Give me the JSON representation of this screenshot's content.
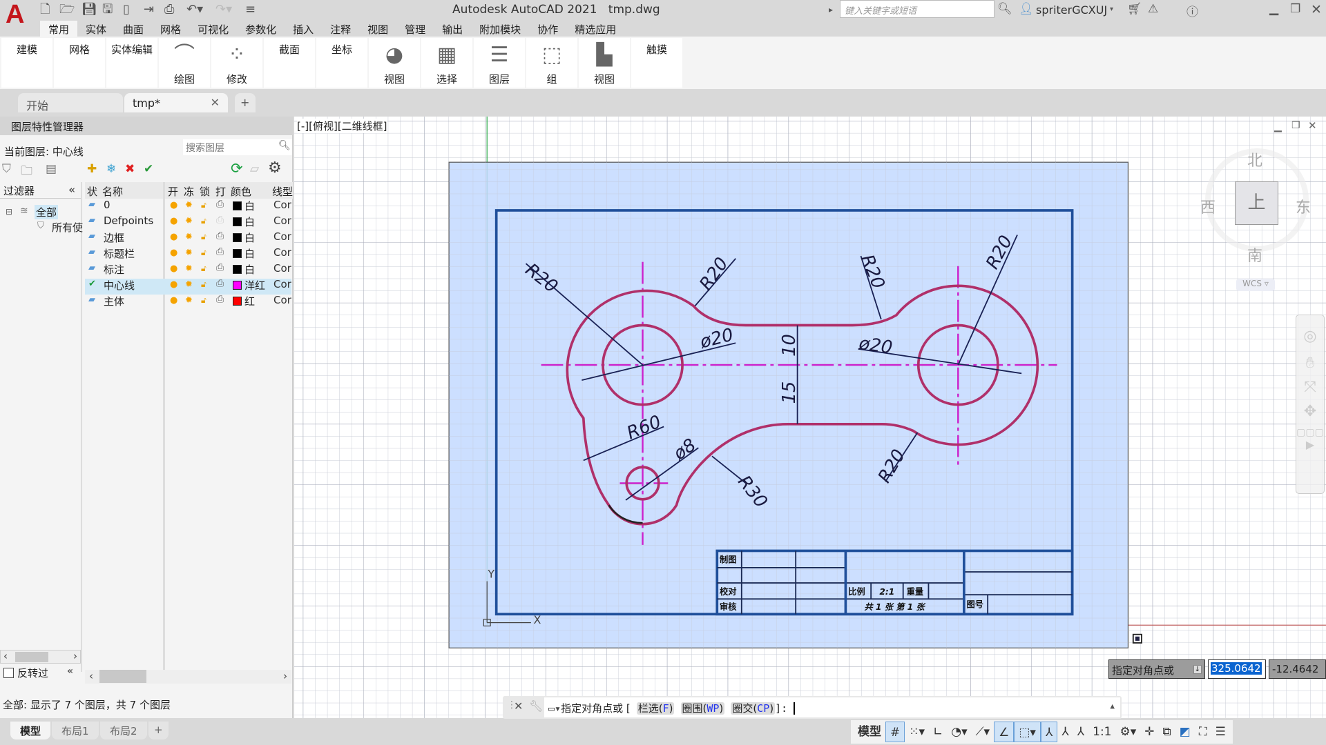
{
  "app": {
    "title": "Autodesk AutoCAD 2021",
    "file": "tmp.dwg",
    "logo_letter": "A",
    "brand_color": "#c4161c"
  },
  "quick_access": [
    "new-icon",
    "open-icon",
    "save-icon",
    "save-as-icon",
    "publish-icon",
    "import-icon",
    "plot-icon",
    "undo-icon",
    "redo-icon",
    "customize-icon"
  ],
  "search": {
    "placeholder": "键入关键字或短语"
  },
  "user": {
    "name": "spriterGCXUJ"
  },
  "menu_tabs": [
    {
      "label": "常用",
      "active": true
    },
    {
      "label": "实体"
    },
    {
      "label": "曲面"
    },
    {
      "label": "网格"
    },
    {
      "label": "可视化"
    },
    {
      "label": "参数化"
    },
    {
      "label": "插入"
    },
    {
      "label": "注释"
    },
    {
      "label": "视图"
    },
    {
      "label": "管理"
    },
    {
      "label": "输出"
    },
    {
      "label": "附加模块"
    },
    {
      "label": "协作"
    },
    {
      "label": "精选应用"
    }
  ],
  "ribbon_panels": [
    {
      "label": "建模"
    },
    {
      "label": "网格"
    },
    {
      "label": "实体编辑"
    },
    {
      "label": "绘图",
      "icon": "arc-draw-icon",
      "glyph": "⌒"
    },
    {
      "label": "修改",
      "icon": "move-icon",
      "glyph": "⁘"
    },
    {
      "label": "截面"
    },
    {
      "label": "坐标"
    },
    {
      "label": "视图",
      "icon": "visual-style-icon",
      "glyph": "◕"
    },
    {
      "label": "选择",
      "icon": "selection-cube-icon",
      "glyph": "▦"
    },
    {
      "label": "图层",
      "icon": "layers-icon",
      "glyph": "☰"
    },
    {
      "label": "组",
      "icon": "group-icon",
      "glyph": "⬚"
    },
    {
      "label": "视图",
      "icon": "view-icon",
      "glyph": "▙"
    },
    {
      "label": "触摸"
    }
  ],
  "doc_tabs": [
    {
      "label": "开始"
    },
    {
      "label": "tmp*",
      "active": true
    }
  ],
  "layer_manager": {
    "title": "图层特性管理器",
    "current_layer_label": "当前图层: 中心线",
    "search_placeholder": "搜索图层",
    "filters_label": "过滤器",
    "filter_tree": [
      "全部",
      "所有使"
    ],
    "invert_label": "反转过",
    "columns": [
      "状",
      "名称",
      "开",
      "冻",
      "锁",
      "打",
      "颜色",
      "线型"
    ],
    "layers": [
      {
        "name": "0",
        "color": "#000000",
        "color_name": "白",
        "linetype": "Cor"
      },
      {
        "name": "Defpoints",
        "color": "#000000",
        "color_name": "白",
        "linetype": "Cor",
        "no_plot": true
      },
      {
        "name": "边框",
        "color": "#000000",
        "color_name": "白",
        "linetype": "Cor"
      },
      {
        "name": "标题栏",
        "color": "#000000",
        "color_name": "白",
        "linetype": "Cor"
      },
      {
        "name": "标注",
        "color": "#000000",
        "color_name": "白",
        "linetype": "Cor"
      },
      {
        "name": "中心线",
        "color": "#ff00ff",
        "color_name": "洋红",
        "linetype": "Cor",
        "current": true
      },
      {
        "name": "主体",
        "color": "#ff0000",
        "color_name": "红",
        "linetype": "Cor"
      }
    ],
    "status": "全部: 显示了 7 个图层，共 7 个图层"
  },
  "viewport": {
    "label": "[-][俯视][二维线框]",
    "viewcube": {
      "north": "北",
      "south": "南",
      "east": "东",
      "west": "西",
      "face": "上",
      "wcs": "WCS"
    },
    "ucs": {
      "x": "X",
      "y": "Y"
    }
  },
  "drawing": {
    "dims": {
      "r20_a": "R20",
      "r20_b": "R20",
      "r20_c": "R20",
      "r20_d": "R20",
      "r20_e": "R20",
      "d20_left": "ø20",
      "d20_right": "ø20",
      "d10": "10",
      "d15": "15",
      "r60": "R60",
      "d8": "ø8",
      "r30": "R30"
    },
    "title_block": {
      "drawn": "制图",
      "checked": "校对",
      "reviewed": "审核",
      "scale_label": "比例",
      "scale": "2:1",
      "weight": "重量",
      "sheets": "共 1 张 第 1 张",
      "drawing_no": "图号"
    },
    "colors": {
      "outline": "#b0306a",
      "centerline": "#cc22cc",
      "frame": "#1f4f9a",
      "selection": "#c3d9ff"
    }
  },
  "coord_tooltip": {
    "prompt": "指定对角点或",
    "x": "325.0642",
    "y": "-12.4642"
  },
  "command_line": {
    "prompt": "指定对角点或 [",
    "options": [
      {
        "text": "栏选(",
        "key": "F"
      },
      {
        "text": "圈围(",
        "key": "WP"
      },
      {
        "text": "圈交(",
        "key": "CP"
      }
    ],
    "end": "]:"
  },
  "layout_tabs": [
    {
      "label": "模型",
      "active": true
    },
    {
      "label": "布局1"
    },
    {
      "label": "布局2"
    }
  ],
  "status_bar": {
    "model_label": "模型",
    "scale": "1:1"
  }
}
